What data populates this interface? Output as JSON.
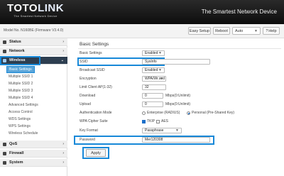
{
  "brand": {
    "logo_main": "TOTO",
    "logo_accent": "LINK",
    "logo_sub": "The Smartest Network Device",
    "tagline": "The Smartest Network Device"
  },
  "topbar": {
    "model": "Model No. N160BE (Firmware V3.4.0)",
    "easy_setup": "Easy Setup",
    "reboot": "Reboot",
    "mode_value": "Auto",
    "help": "Help"
  },
  "sidebar": {
    "sections": {
      "status": "Status",
      "network": "Network",
      "wireless": "Wireless",
      "qos": "QoS",
      "firewall": "Firewall",
      "system": "System"
    },
    "wireless_items": [
      "Basic Settings",
      "Multiple SSID 1",
      "Multiple SSID 2",
      "Multiple SSID 3",
      "Multiple SSID 4",
      "Advanced Settings",
      "Access Control",
      "WDS Settings",
      "WPS Settings",
      "Wireless Schedule"
    ]
  },
  "main": {
    "title": "Basic Settings",
    "rows": {
      "basic_settings": {
        "label": "Basic Settings",
        "value": "Enabled"
      },
      "ssid": {
        "label": "SSID",
        "value": "SysInfo"
      },
      "broadcast_ssid": {
        "label": "Broadcast SSID",
        "value": "Enabled"
      },
      "encryption": {
        "label": "Encryption",
        "value": "WPA/Wr.sed"
      },
      "limit_client": {
        "label": "Limit Client AP(1-32)",
        "value": "32"
      },
      "download": {
        "label": "Download",
        "value": "0",
        "unit": "Mbps(0:Unlimit)"
      },
      "upload": {
        "label": "Upload",
        "value": "0",
        "unit": "Mbps(0:Unlimit)"
      },
      "auth_mode": {
        "label": "Authentication Mode",
        "option1": "Enterprise (RADIUS)",
        "option2": "Personal (Pre-Shared Key)",
        "selected": "option2"
      },
      "wpa_cipher": {
        "label": "WPA Cipher Suite",
        "option1": "TKIP",
        "option2": "AES",
        "checked": [
          "option1"
        ]
      },
      "key_format": {
        "label": "Key Format",
        "value": "Passphrase"
      },
      "password": {
        "label": "Password",
        "value": "Mer120308"
      }
    },
    "apply": "Apply"
  },
  "colors": {
    "highlight": "#1788d8",
    "active_nav": "#2d3e50",
    "header": "#111111"
  }
}
